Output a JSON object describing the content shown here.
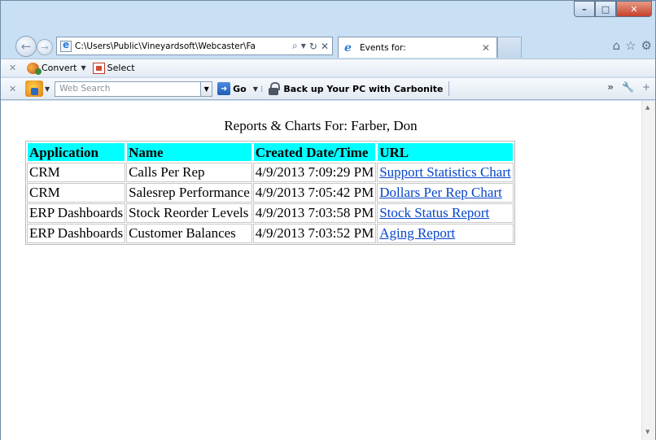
{
  "browser": {
    "address": "C:\\Users\\Public\\Vineyardsoft\\Webcaster\\Fa",
    "tab_title": "Events for:",
    "toolbar1": {
      "convert_label": "Convert",
      "select_label": "Select"
    },
    "toolbar2": {
      "search_placeholder": "Web Search",
      "go_label": "Go",
      "carbonite_label": "Back up Your PC with Carbonite",
      "overflow_label": "»"
    }
  },
  "page": {
    "title": "Reports & Charts For: Farber, Don",
    "columns": [
      "Application",
      "Name",
      "Created Date/Time",
      "URL"
    ],
    "rows": [
      {
        "application": "CRM",
        "name": "Calls Per Rep",
        "created": "4/9/2013 7:09:29 PM",
        "url": "Support Statistics Chart"
      },
      {
        "application": "CRM",
        "name": "Salesrep Performance",
        "created": "4/9/2013 7:05:42 PM",
        "url": "Dollars Per Rep Chart"
      },
      {
        "application": "ERP Dashboards",
        "name": "Stock Reorder Levels",
        "created": "4/9/2013 7:03:58 PM",
        "url": "Stock Status Report"
      },
      {
        "application": "ERP Dashboards",
        "name": "Customer Balances",
        "created": "4/9/2013 7:03:52 PM",
        "url": "Aging Report"
      }
    ]
  },
  "colors": {
    "header_bg": "#00ffff",
    "link": "#0645c9"
  }
}
